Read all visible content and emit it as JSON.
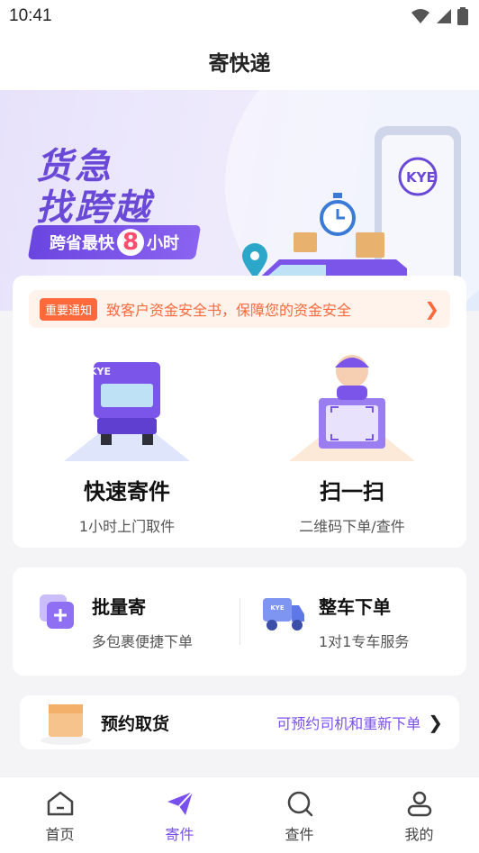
{
  "status_bar": {
    "time": "10:41"
  },
  "header": {
    "title": "寄快递"
  },
  "banner": {
    "line1": "货急",
    "line2": "找跨越",
    "tag_prefix": "跨省最快",
    "tag_number": "8",
    "tag_suffix": "小时",
    "truck_logo": "KYE"
  },
  "notice": {
    "badge": "重要通知",
    "text": "致客户资金安全书，保障您的资金安全"
  },
  "services": [
    {
      "title": "快速寄件",
      "subtitle": "1小时上门取件",
      "icon": "truck-icon",
      "logo": "KYE"
    },
    {
      "title": "扫一扫",
      "subtitle": "二维码下单/查件",
      "icon": "scan-icon"
    }
  ],
  "mini_services": [
    {
      "title": "批量寄",
      "subtitle": "多包裹便捷下单",
      "icon": "batch-icon"
    },
    {
      "title": "整车下单",
      "subtitle": "1对1专车服务",
      "icon": "truck-order-icon",
      "logo": "KYE"
    }
  ],
  "booking": {
    "title": "预约取货",
    "link": "可预约司机和重新下单"
  },
  "tabs": [
    {
      "label": "首页",
      "icon": "home-icon",
      "active": false
    },
    {
      "label": "寄件",
      "icon": "send-icon",
      "active": true
    },
    {
      "label": "查件",
      "icon": "search-icon",
      "active": false
    },
    {
      "label": "我的",
      "icon": "profile-icon",
      "active": false
    }
  ],
  "colors": {
    "brand": "#7a4ff0",
    "notice": "#ff6a3d"
  }
}
